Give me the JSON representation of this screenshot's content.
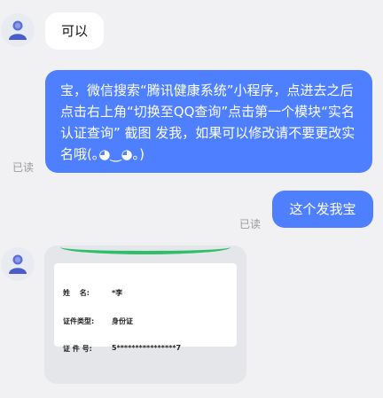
{
  "messages": [
    {
      "direction": "in",
      "text": "可以"
    },
    {
      "direction": "out",
      "text": "宝，微信搜索“腾讯健康系统”小程序，点进去之后点击右上角“切换至QQ查询”点击第一个模块“实名认证查询” 截图 发我，如果可以修改请不要更改实名哦(｡◕‿◕｡)",
      "status": "已读"
    },
    {
      "direction": "out",
      "text": "这个发我宝",
      "status": "已读"
    },
    {
      "direction": "in",
      "type": "image",
      "card": {
        "rows": [
          {
            "label": "姓　 名:",
            "value": "*李"
          },
          {
            "label": "证件类型:",
            "value": "身份证"
          },
          {
            "label": "证  件  号:",
            "value": "5****************7"
          }
        ]
      }
    }
  ],
  "colors": {
    "outgoing": "#4e7fff",
    "incoming": "#ffffff",
    "background": "#f1f1f3"
  }
}
